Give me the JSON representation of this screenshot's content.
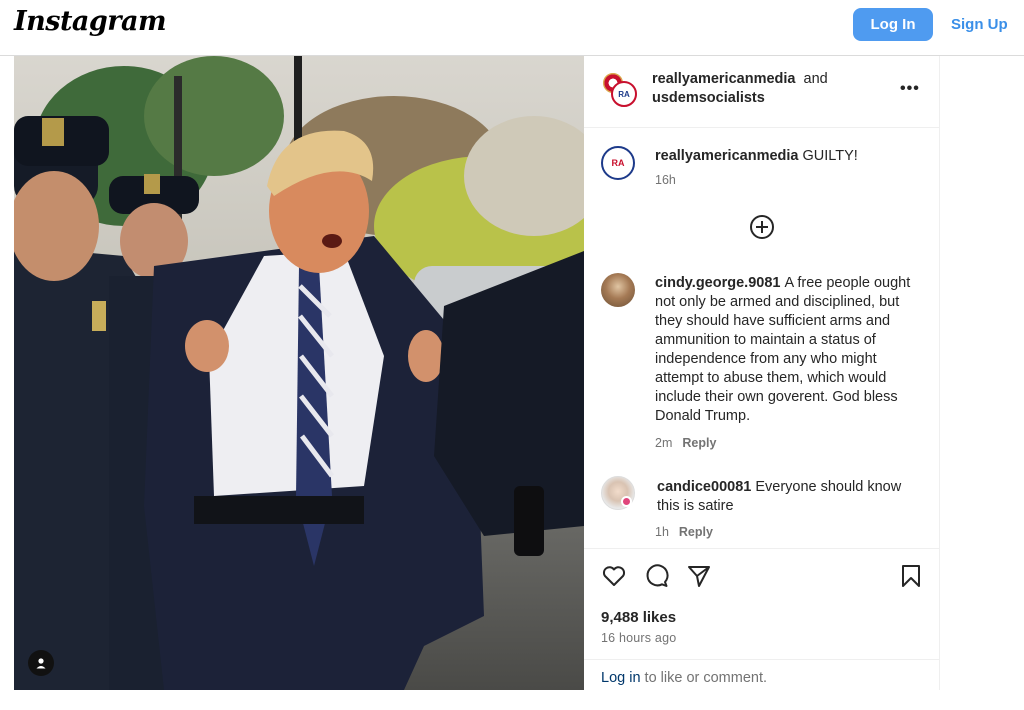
{
  "header": {
    "logo": "Instagram",
    "login_label": "Log In",
    "signup_label": "Sign Up"
  },
  "post": {
    "author_1": "reallyamericanmedia",
    "connector": "and",
    "author_2": "usdemsocialists",
    "avatar_text": "RA"
  },
  "comments": [
    {
      "user": "reallyamericanmedia",
      "text": "GUILTY!",
      "time": "16h",
      "reply": "",
      "avatar_text": "RA"
    },
    {
      "user": "cindy.george.9081",
      "text": "A free people ought not only be armed and disciplined, but they should have sufficient arms and ammunition to maintain a status of independence from any who might attempt to abuse them, which would include their own goverent. God bless Donald Trump.",
      "time": "2m",
      "reply": "Reply"
    },
    {
      "user": "candice00081",
      "text": "Everyone should know this is satire",
      "time": "1h",
      "reply": "Reply"
    }
  ],
  "stats": {
    "likes": "9,488 likes",
    "posted": "16 hours ago"
  },
  "footer": {
    "login_link": "Log in",
    "login_rest": " to like or comment."
  },
  "icons": {
    "more": "more-horizontal-icon",
    "load_more": "plus-circle-icon",
    "like": "heart-icon",
    "comment": "comment-icon",
    "share": "send-icon",
    "save": "bookmark-icon",
    "user_tag": "person-icon"
  },
  "colors": {
    "primary_button": "#4f9bf0",
    "link": "#3a8fe8",
    "secondary_text": "#737373"
  }
}
